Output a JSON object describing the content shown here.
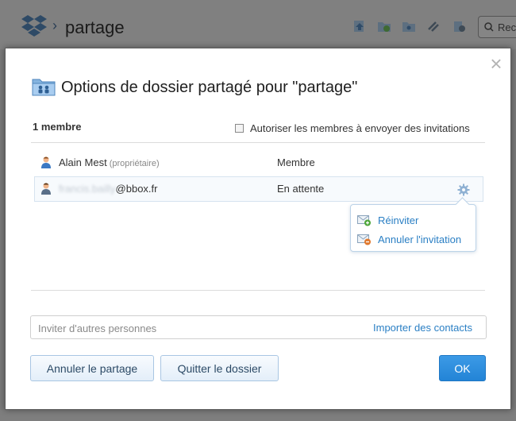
{
  "background": {
    "breadcrumb_title": "partage",
    "search_placeholder": "Rec"
  },
  "modal": {
    "title": "Options de dossier partagé pour \"partage\"",
    "close_glyph": "×",
    "member_count": "1 membre",
    "allow_invites_label": "Autoriser les membres à envoyer des invitations",
    "allow_invites_checked": false
  },
  "members": [
    {
      "name": "Alain Mest",
      "tag": "(propriétaire)",
      "role": "Membre"
    },
    {
      "email_hidden": "francis.bailly",
      "email_domain": "@bbox.fr",
      "role": "En attente"
    }
  ],
  "popover": {
    "reinvite": "Réinviter",
    "cancel_invite": "Annuler l'invitation"
  },
  "invite": {
    "placeholder": "Inviter d'autres personnes",
    "import_link": "Importer des contacts"
  },
  "buttons": {
    "unshare": "Annuler le partage",
    "leave": "Quitter le dossier",
    "ok": "OK"
  },
  "colors": {
    "accent": "#2a7fc4",
    "ok_button": "#2384d6"
  },
  "icons": [
    "dropbox-logo-icon",
    "chevron-right-icon",
    "upload-icon",
    "new-folder-icon",
    "shared-folder-icon",
    "link-icon",
    "deleted-files-icon",
    "search-icon",
    "shared-folder-icon",
    "person-icon",
    "gear-icon",
    "mail-add-icon",
    "mail-remove-icon",
    "close-icon"
  ]
}
